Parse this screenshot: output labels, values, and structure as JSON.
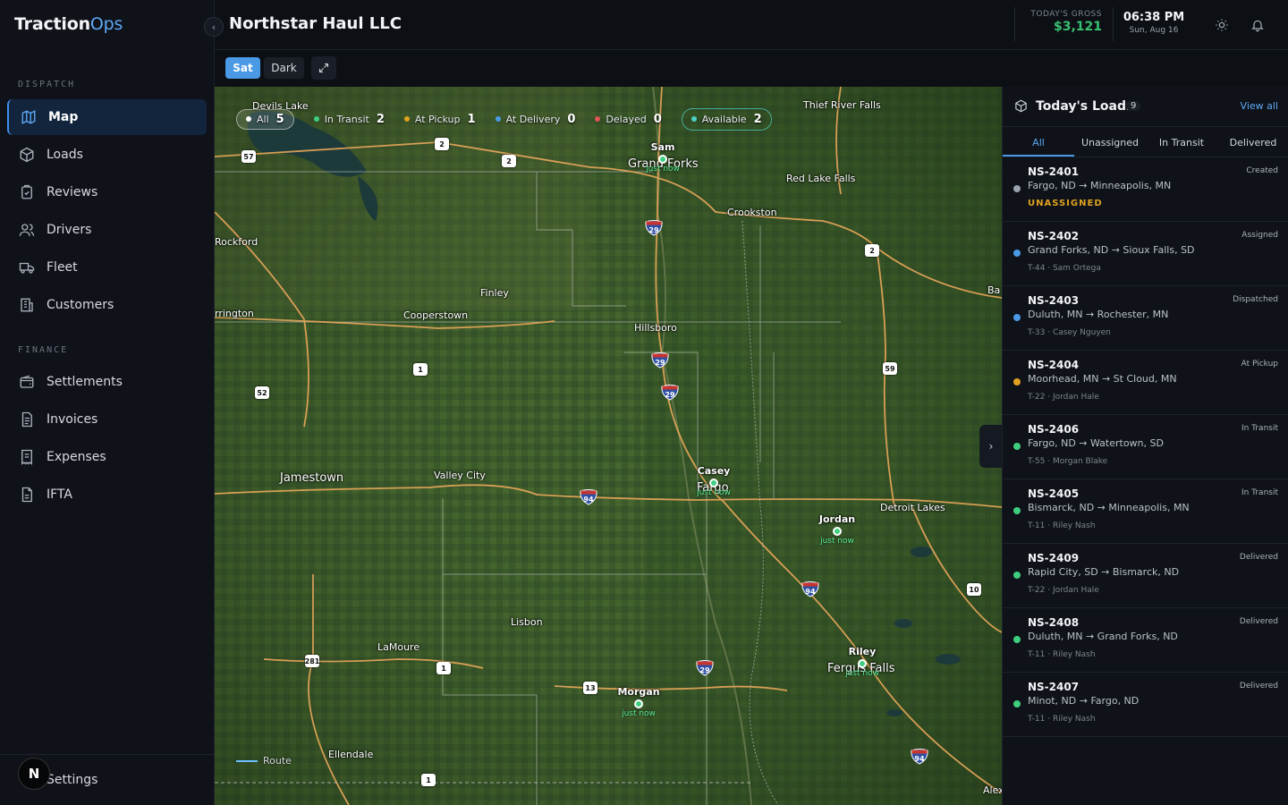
{
  "brand": {
    "name_a": "Traction",
    "name_b": "Ops"
  },
  "sidebar": {
    "dispatch_label": "DISPATCH",
    "finance_label": "FINANCE",
    "dispatch_items": [
      {
        "label": "Map",
        "icon": "map-icon"
      },
      {
        "label": "Loads",
        "icon": "box-icon"
      },
      {
        "label": "Reviews",
        "icon": "clipboard-icon"
      },
      {
        "label": "Drivers",
        "icon": "users-icon"
      },
      {
        "label": "Fleet",
        "icon": "truck-icon"
      },
      {
        "label": "Customers",
        "icon": "building-icon"
      }
    ],
    "finance_items": [
      {
        "label": "Settlements",
        "icon": "wallet-icon"
      },
      {
        "label": "Invoices",
        "icon": "document-icon"
      },
      {
        "label": "Expenses",
        "icon": "receipt-icon"
      },
      {
        "label": "IFTA",
        "icon": "file-icon"
      }
    ],
    "settings_label": "Settings",
    "avatar_initial": "N"
  },
  "header": {
    "company": "Northstar Haul LLC",
    "gross_label": "TODAY'S GROSS",
    "gross_value": "$3,121",
    "time": "06:38 PM",
    "date": "Sun, Aug 16"
  },
  "toolbar": {
    "sat": "Sat",
    "dark": "Dark"
  },
  "map": {
    "legend": [
      {
        "label": "All",
        "count": "5",
        "color": "#ffffff"
      },
      {
        "label": "In Transit",
        "count": "2",
        "color": "#3fcf7f"
      },
      {
        "label": "At Pickup",
        "count": "1",
        "color": "#e0a21f"
      },
      {
        "label": "At Delivery",
        "count": "0",
        "color": "#4a9ae6"
      },
      {
        "label": "Delayed",
        "count": "0",
        "color": "#e05555"
      },
      {
        "label": "Available",
        "count": "2",
        "color": "#4fd1c5"
      }
    ],
    "route_label": "Route",
    "cities": [
      "Devils Lake",
      "Thief River Falls",
      "Grand Forks",
      "Red Lake Falls",
      "Crookston",
      "Rockford",
      "Finley",
      "rrington",
      "Cooperstown",
      "Hillsboro",
      "Jamestown",
      "Valley City",
      "Fargo",
      "Detroit Lakes",
      "Lisbon",
      "LaMoure",
      "Fergus Falls",
      "Ellendale",
      "Ba",
      "Alex"
    ],
    "shields": [
      "2",
      "2",
      "57",
      "2",
      "1",
      "52",
      "59",
      "1",
      "281",
      "13",
      "1",
      "10"
    ],
    "interstates": [
      "29",
      "29",
      "29",
      "94",
      "94",
      "29",
      "94"
    ],
    "trucks": [
      {
        "name": "Sam",
        "ago": "just now"
      },
      {
        "name": "Casey",
        "ago": "just now"
      },
      {
        "name": "Jordan",
        "ago": "just now"
      },
      {
        "name": "Riley",
        "ago": "just now"
      },
      {
        "name": "Morgan",
        "ago": "just now"
      }
    ]
  },
  "panel": {
    "title": "Today's Loads",
    "count": "9",
    "view_all": "View all",
    "tabs": [
      "All",
      "Unassigned",
      "In Transit",
      "Delivered"
    ],
    "loads": [
      {
        "id": "NS-2401",
        "route": "Fargo, ND → Minneapolis, MN",
        "sub": "UNASSIGNED",
        "status": "Created",
        "color": "#9aa3ae"
      },
      {
        "id": "NS-2402",
        "route": "Grand Forks, ND → Sioux Falls, SD",
        "sub": "T-44 · Sam Ortega",
        "status": "Assigned",
        "color": "#4a9ae6"
      },
      {
        "id": "NS-2403",
        "route": "Duluth, MN → Rochester, MN",
        "sub": "T-33 · Casey Nguyen",
        "status": "Dispatched",
        "color": "#4a9ae6"
      },
      {
        "id": "NS-2404",
        "route": "Moorhead, MN → St Cloud, MN",
        "sub": "T-22 · Jordan Hale",
        "status": "At Pickup",
        "color": "#e0a21f"
      },
      {
        "id": "NS-2406",
        "route": "Fargo, ND → Watertown, SD",
        "sub": "T-55 · Morgan Blake",
        "status": "In Transit",
        "color": "#3fcf7f"
      },
      {
        "id": "NS-2405",
        "route": "Bismarck, ND → Minneapolis, MN",
        "sub": "T-11 · Riley Nash",
        "status": "In Transit",
        "color": "#3fcf7f"
      },
      {
        "id": "NS-2409",
        "route": "Rapid City, SD → Bismarck, ND",
        "sub": "T-22 · Jordan Hale",
        "status": "Delivered",
        "color": "#3fcf7f"
      },
      {
        "id": "NS-2408",
        "route": "Duluth, MN → Grand Forks, ND",
        "sub": "T-11 · Riley Nash",
        "status": "Delivered",
        "color": "#3fcf7f"
      },
      {
        "id": "NS-2407",
        "route": "Minot, ND → Fargo, ND",
        "sub": "T-11 · Riley Nash",
        "status": "Delivered",
        "color": "#3fcf7f"
      }
    ]
  }
}
